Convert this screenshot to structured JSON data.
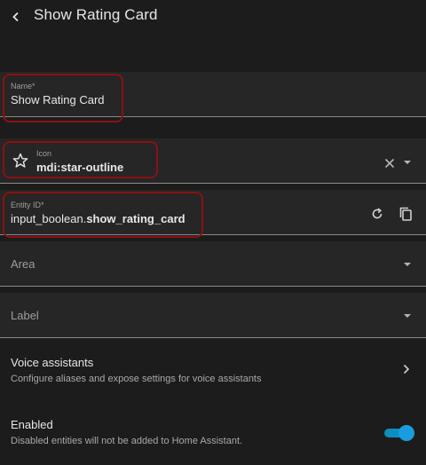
{
  "header": {
    "title": "Show Rating Card",
    "back_icon": "chevron-left-icon"
  },
  "name_field": {
    "label": "Name*",
    "value": "Show Rating Card"
  },
  "icon_field": {
    "label": "Icon",
    "value": "mdi:star-outline",
    "icon": "star-outline-icon"
  },
  "entity_field": {
    "label": "Entity ID*",
    "value_prefix": "input_boolean.",
    "value_suffix": "show_rating_card"
  },
  "area_field": {
    "placeholder": "Area"
  },
  "label_field": {
    "placeholder": "Label"
  },
  "voice": {
    "title": "Voice assistants",
    "subtitle": "Configure aliases and expose settings for voice assistants"
  },
  "enabled": {
    "title": "Enabled",
    "subtitle": "Disabled entities will not be added to Home Assistant.",
    "value": true
  },
  "colors": {
    "highlight": "#8b1111",
    "toggle_accent": "#1a9de0"
  }
}
